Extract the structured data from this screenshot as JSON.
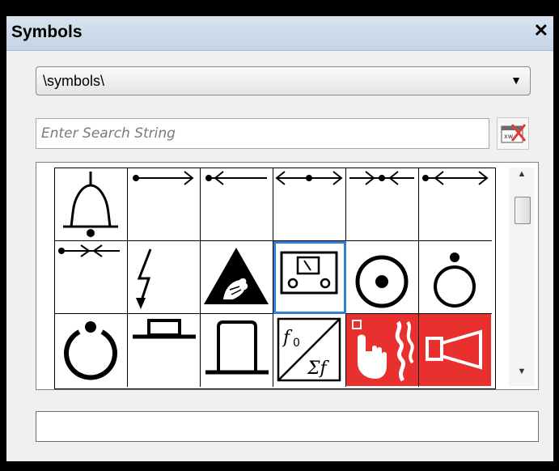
{
  "window": {
    "title": "Symbols",
    "close_glyph": "✕"
  },
  "library": {
    "selected": "\\symbols\\",
    "arrow_glyph": "▼"
  },
  "search": {
    "placeholder": "Enter Search String",
    "value": "",
    "clear_icon": "clear-search-icon"
  },
  "symbols": [
    {
      "icon": "bell-icon"
    },
    {
      "icon": "arrow-dot-right-icon"
    },
    {
      "icon": "arrow-dot-left-icon"
    },
    {
      "icon": "double-arrow-dot-icon"
    },
    {
      "icon": "converging-arrows-dot-icon"
    },
    {
      "icon": "dot-double-arrow-icon"
    },
    {
      "icon": "small-converging-arrows-icon"
    },
    {
      "icon": "lightning-icon"
    },
    {
      "icon": "esd-warning-icon"
    },
    {
      "icon": "meter-box-icon",
      "selected": true
    },
    {
      "icon": "circle-dot-icon"
    },
    {
      "icon": "circle-dot-top-icon"
    },
    {
      "icon": "open-circle-icon"
    },
    {
      "icon": "short-button-icon"
    },
    {
      "icon": "tall-button-icon"
    },
    {
      "icon": "f0-sigma-f-icon"
    },
    {
      "icon": "fire-alarm-button-icon"
    },
    {
      "icon": "fire-horn-icon"
    }
  ],
  "scrollbar": {
    "up_glyph": "▲",
    "down_glyph": "▼"
  },
  "colors": {
    "title_bar": "#c3d3e6",
    "selection": "#2e7fd6",
    "fire_red": "#e8302e"
  },
  "status": {
    "value": ""
  }
}
